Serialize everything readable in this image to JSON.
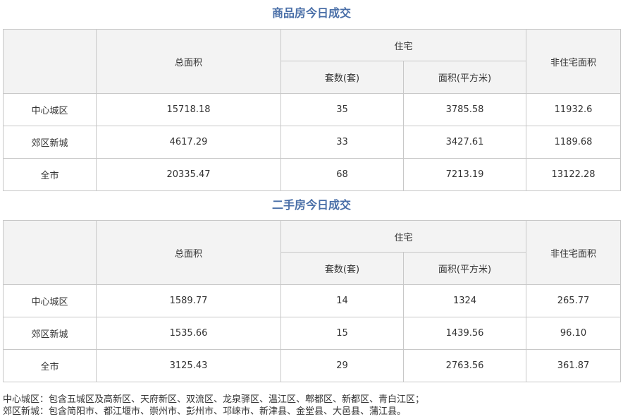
{
  "tables": [
    {
      "title": "商品房今日成交",
      "headers": {
        "total_area": "总面积",
        "residential": "住宅",
        "units": "套数(套)",
        "area": "面积(平方米)",
        "non_residential": "非住宅面积"
      },
      "rows": [
        {
          "region": "中心城区",
          "total_area": "15718.18",
          "units": "35",
          "area": "3785.58",
          "non_residential": "11932.6"
        },
        {
          "region": "郊区新城",
          "total_area": "4617.29",
          "units": "33",
          "area": "3427.61",
          "non_residential": "1189.68"
        },
        {
          "region": "全市",
          "total_area": "20335.47",
          "units": "68",
          "area": "7213.19",
          "non_residential": "13122.28"
        }
      ]
    },
    {
      "title": "二手房今日成交",
      "headers": {
        "total_area": "总面积",
        "residential": "住宅",
        "units": "套数(套)",
        "area": "面积(平方米)",
        "non_residential": "非住宅面积"
      },
      "rows": [
        {
          "region": "中心城区",
          "total_area": "1589.77",
          "units": "14",
          "area": "1324",
          "non_residential": "265.77"
        },
        {
          "region": "郊区新城",
          "total_area": "1535.66",
          "units": "15",
          "area": "1439.56",
          "non_residential": "96.10"
        },
        {
          "region": "全市",
          "total_area": "3125.43",
          "units": "29",
          "area": "2763.56",
          "non_residential": "361.87"
        }
      ]
    }
  ],
  "notes": [
    "中心城区：包含五城区及高新区、天府新区、双流区、龙泉驿区、温江区、郫都区、新都区、青白江区；",
    "郊区新城：包含简阳市、都江堰市、崇州市、彭州市、邛崃市、新津县、金堂县、大邑县、蒲江县。"
  ],
  "colors": {
    "title": "#4a6fa8",
    "header_bg": "#f3f3f3",
    "border": "#c8c8c8"
  }
}
